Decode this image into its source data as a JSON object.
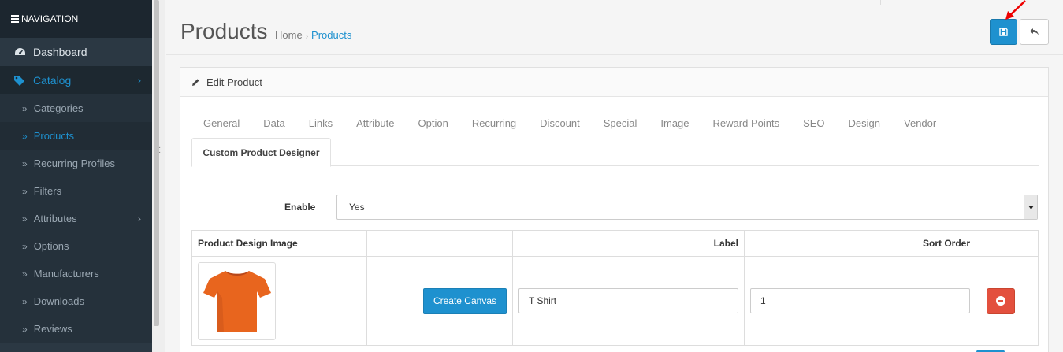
{
  "nav": {
    "header": "NAVIGATION",
    "dashboard": "Dashboard",
    "catalog": "Catalog",
    "items": [
      {
        "label": "Categories"
      },
      {
        "label": "Products"
      },
      {
        "label": "Recurring Profiles"
      },
      {
        "label": "Filters"
      },
      {
        "label": "Attributes"
      },
      {
        "label": "Options"
      },
      {
        "label": "Manufacturers"
      },
      {
        "label": "Downloads"
      },
      {
        "label": "Reviews"
      }
    ]
  },
  "header": {
    "title": "Products",
    "breadcrumb": {
      "home": "Home",
      "current": "Products"
    }
  },
  "panel": {
    "title": "Edit Product",
    "tabs": [
      "General",
      "Data",
      "Links",
      "Attribute",
      "Option",
      "Recurring",
      "Discount",
      "Special",
      "Image",
      "Reward Points",
      "SEO",
      "Design",
      "Vendor"
    ],
    "active_tab": "Custom Product Designer",
    "enable": {
      "label": "Enable",
      "value": "Yes"
    },
    "table": {
      "headers": {
        "image": "Product Design Image",
        "label": "Label",
        "sort_order": "Sort Order"
      },
      "rows": [
        {
          "button": "Create Canvas",
          "label": "T Shirt",
          "sort_order": "1"
        }
      ]
    }
  },
  "colors": {
    "accent": "#1e91cf",
    "sidebar": "#2b3843",
    "danger": "#e3503e",
    "shirt": "#e8651e"
  }
}
